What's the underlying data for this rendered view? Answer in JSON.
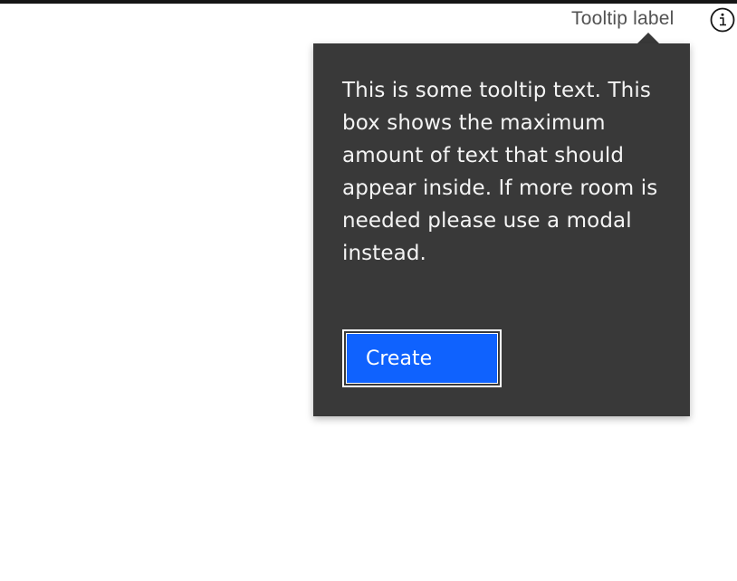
{
  "trigger": {
    "label": "Tooltip label",
    "icon": "info-icon"
  },
  "tooltip": {
    "text": "This is some tooltip text. This box shows the maximum amount of text that should appear inside. If more room is needed please use a modal instead.",
    "button_label": "Create"
  },
  "colors": {
    "tooltip_bg": "#393939",
    "tooltip_text": "#f4f4f4",
    "button_bg": "#0f62fe",
    "label_text": "#525252",
    "top_border": "#161616"
  }
}
